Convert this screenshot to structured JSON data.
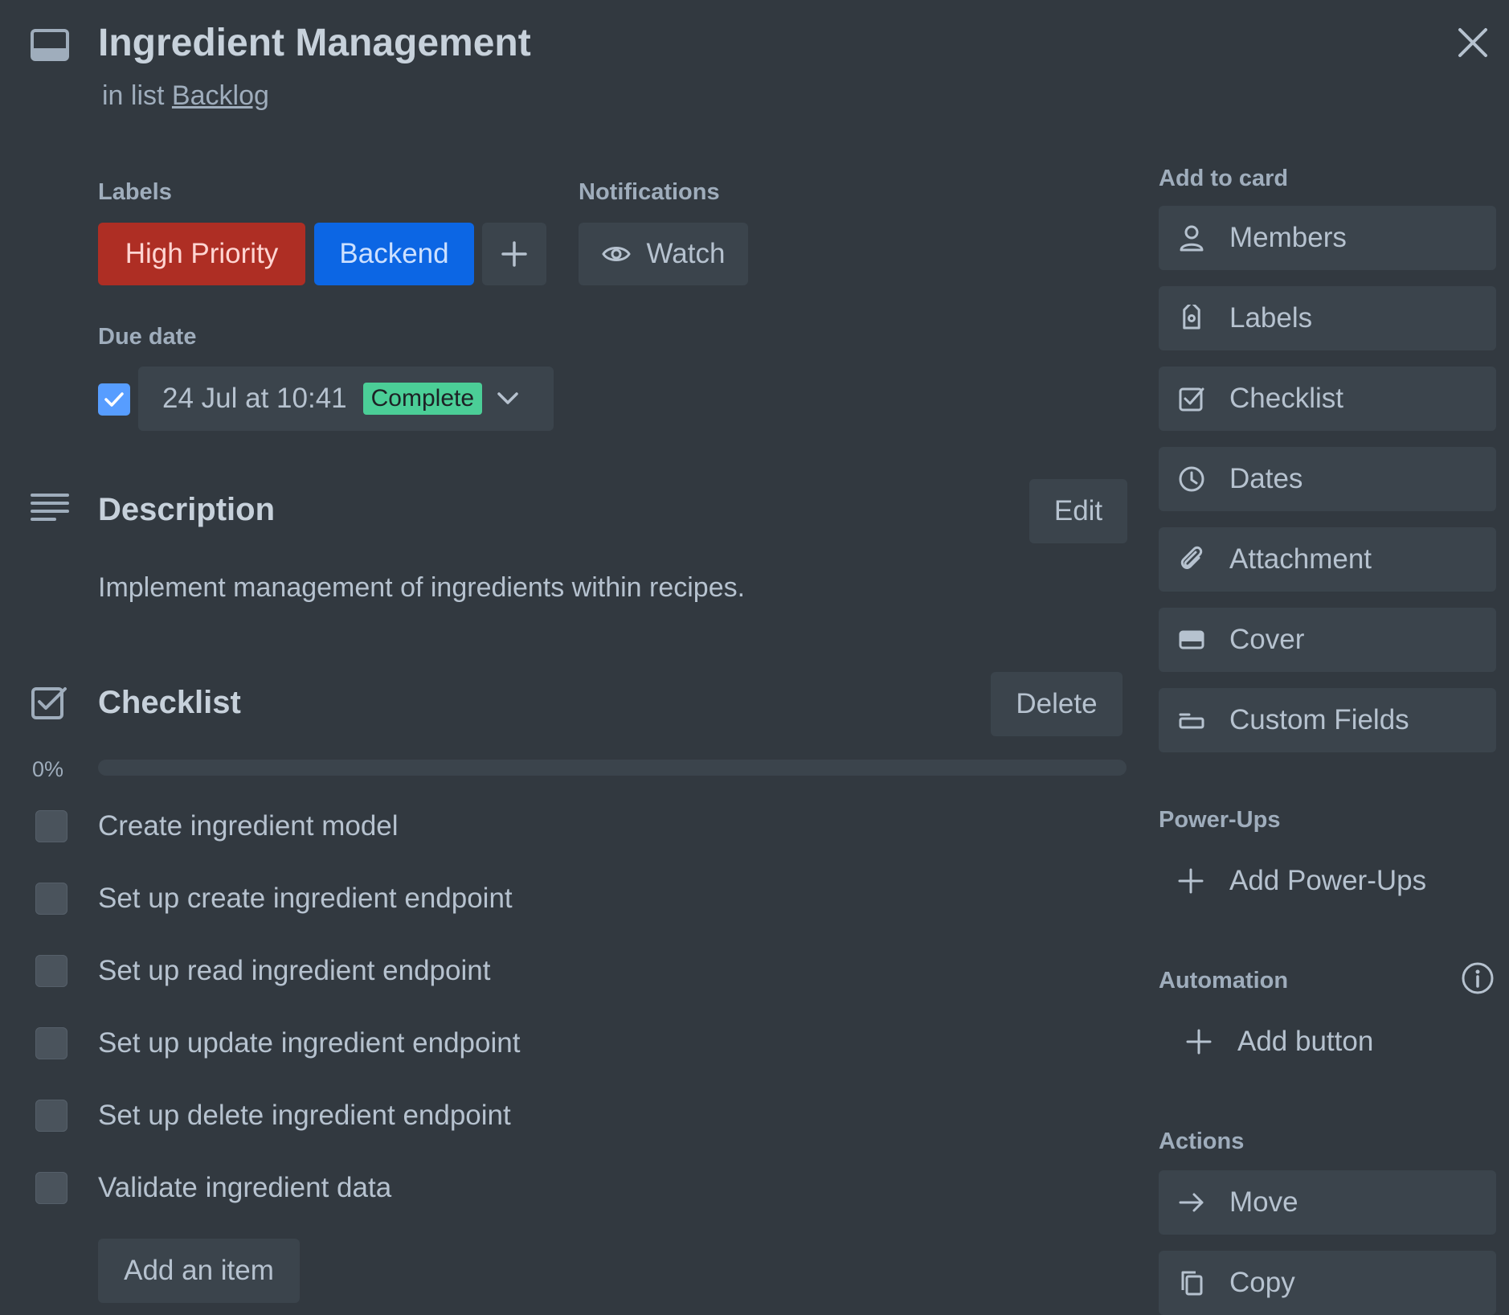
{
  "header": {
    "title": "Ingredient Management",
    "list_prefix": "in list",
    "list_name": "Backlog"
  },
  "labels_section": {
    "heading": "Labels",
    "labels": [
      {
        "name": "High Priority",
        "color": "#ae2e24"
      },
      {
        "name": "Backend",
        "color": "#0c66e4"
      }
    ]
  },
  "notifications": {
    "heading": "Notifications",
    "watch_label": "Watch"
  },
  "due_date": {
    "heading": "Due date",
    "value": "24 Jul at 10:41",
    "status": "Complete",
    "checked": true
  },
  "description": {
    "heading": "Description",
    "edit_label": "Edit",
    "text": "Implement management of ingredients within recipes."
  },
  "checklist": {
    "heading": "Checklist",
    "delete_label": "Delete",
    "progress_text": "0%",
    "progress": 0,
    "items": [
      {
        "text": "Create ingredient model",
        "checked": false
      },
      {
        "text": "Set up create ingredient endpoint",
        "checked": false
      },
      {
        "text": "Set up read ingredient endpoint",
        "checked": false
      },
      {
        "text": "Set up update ingredient endpoint",
        "checked": false
      },
      {
        "text": "Set up delete ingredient endpoint",
        "checked": false
      },
      {
        "text": "Validate ingredient data",
        "checked": false
      }
    ],
    "add_item_label": "Add an item"
  },
  "sidebar": {
    "add_to_card_heading": "Add to card",
    "add_to_card": [
      {
        "label": "Members",
        "icon": "person-icon"
      },
      {
        "label": "Labels",
        "icon": "tag-icon"
      },
      {
        "label": "Checklist",
        "icon": "checkbox-icon"
      },
      {
        "label": "Dates",
        "icon": "clock-icon"
      },
      {
        "label": "Attachment",
        "icon": "paperclip-icon"
      },
      {
        "label": "Cover",
        "icon": "cover-icon"
      },
      {
        "label": "Custom Fields",
        "icon": "field-icon"
      }
    ],
    "powerups_heading": "Power-Ups",
    "add_powerups_label": "Add Power-Ups",
    "automation_heading": "Automation",
    "add_button_label": "Add button",
    "actions_heading": "Actions",
    "actions": [
      {
        "label": "Move",
        "icon": "arrow-right-icon"
      },
      {
        "label": "Copy",
        "icon": "copy-icon"
      }
    ]
  },
  "colors": {
    "background": "#323940",
    "button": "#3b444c",
    "text": "#b6c2cf",
    "accent": "#579dff",
    "complete_badge": "#4bce97"
  }
}
